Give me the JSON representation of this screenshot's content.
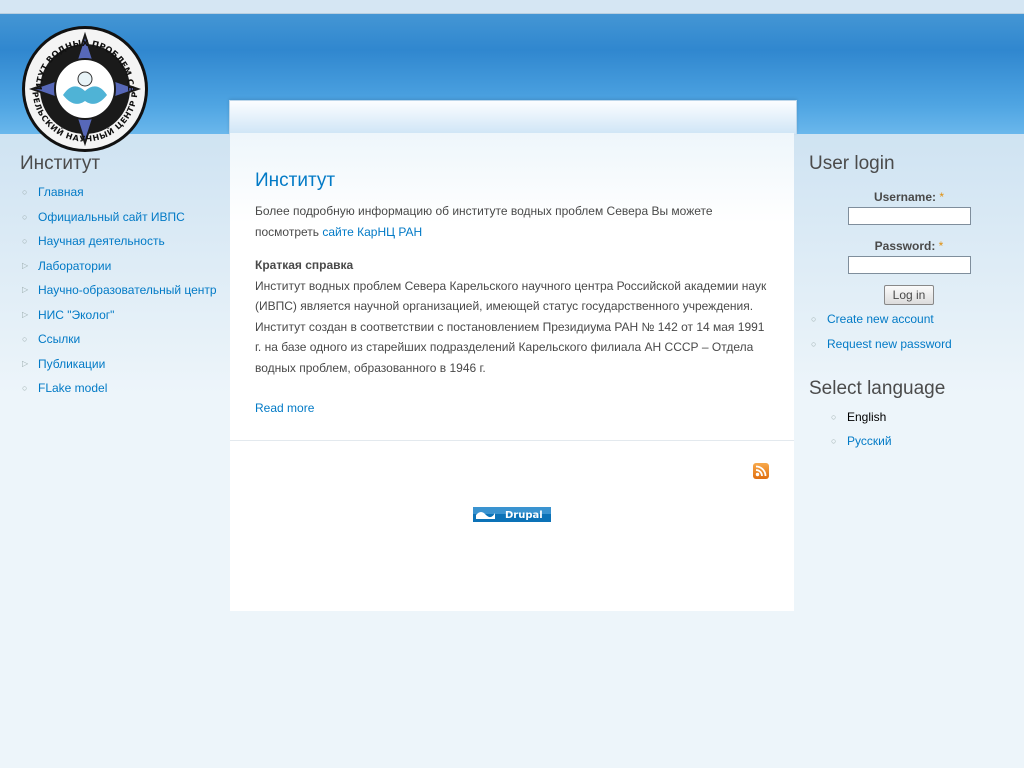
{
  "site": {
    "logo_text_outer": "ИНСТИТУТ ВОДНЫХ ПРОБЛЕМ СЕВЕРА",
    "logo_text_inner": "КАРЕЛЬСКИЙ НАУЧНЫЙ ЦЕНТР РАН"
  },
  "sidebar": {
    "title": "Институт",
    "items": [
      {
        "label": "Главная",
        "bullet": "circle"
      },
      {
        "label": "Официальный сайт ИВПС",
        "bullet": "circle"
      },
      {
        "label": "Научная деятельность",
        "bullet": "circle"
      },
      {
        "label": "Лаборатории",
        "bullet": "triangle"
      },
      {
        "label": "Научно-образовательный центр",
        "bullet": "triangle"
      },
      {
        "label": "НИС \"Эколог\"",
        "bullet": "triangle"
      },
      {
        "label": "Ссылки",
        "bullet": "circle"
      },
      {
        "label": "Публикации",
        "bullet": "triangle"
      },
      {
        "label": "FLake model",
        "bullet": "circle"
      }
    ]
  },
  "main": {
    "title": "Институт",
    "intro_text": "Более подробную информацию об институте водных проблем Севера Вы можете посмотреть",
    "intro_link": "сайте КарНЦ РАН",
    "summary_heading": "Краткая справка",
    "summary_text": "Институт водных проблем Севера Карельского научного центра Российской академии наук (ИВПС) является научной организацией, имеющей статус государственного учреждения. Институт создан в соответствии с постановлением Президиума РАН № 142 от 14 мая 1991 г. на базе одного из старейших подразделений Карельского филиала АН СССР – Отдела водных проблем, образованного в 1946 г.",
    "read_more": "Read more",
    "rss_icon": "rss-feed-icon",
    "drupal_badge": "Drupal"
  },
  "login": {
    "title": "User login",
    "username_label": "Username:",
    "password_label": "Password:",
    "required_mark": "*",
    "submit_label": "Log in",
    "links": [
      "Create new account",
      "Request new password"
    ]
  },
  "language": {
    "title": "Select language",
    "items": [
      {
        "label": "English",
        "active": true
      },
      {
        "label": "Русский",
        "active": false
      }
    ]
  },
  "colors": {
    "link": "#027ac6",
    "header": "#3087cf",
    "background": "#edf5fa",
    "required": "#e09010"
  }
}
